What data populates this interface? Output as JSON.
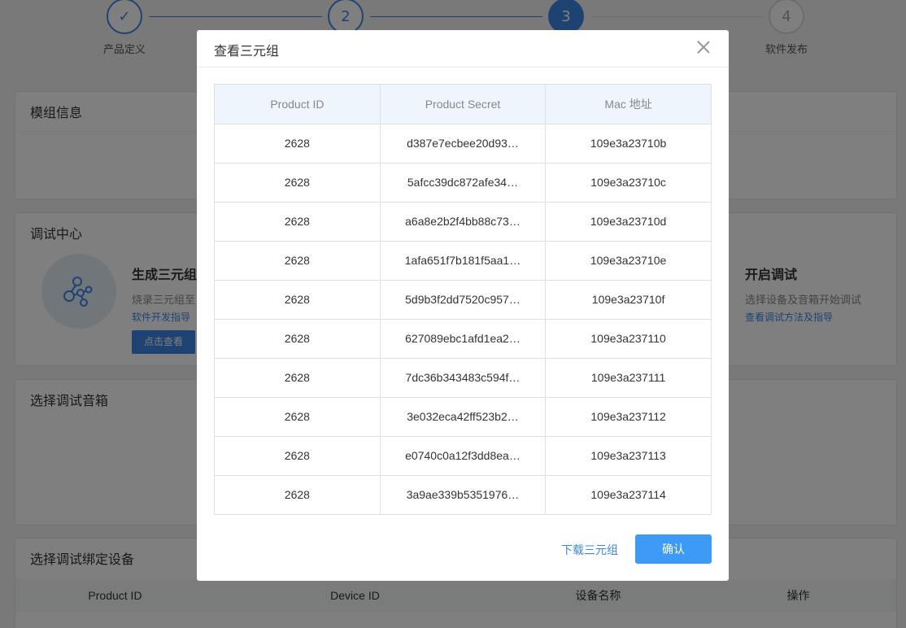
{
  "steps": [
    {
      "number": "✓",
      "label": "产品定义",
      "state": "done"
    },
    {
      "number": "2",
      "label": "",
      "state": "done"
    },
    {
      "number": "3",
      "label": "",
      "state": "current"
    },
    {
      "number": "4",
      "label": "软件发布",
      "state": "todo"
    }
  ],
  "cards": {
    "module_info": {
      "title": "模组信息"
    },
    "debug_center": {
      "title": "调试中心",
      "generate": {
        "heading": "生成三元组",
        "desc": "烧录三元组至",
        "link": "软件开发指导",
        "button": "点击查看"
      },
      "start": {
        "heading": "开启调试",
        "desc": "选择设备及音箱开始调试",
        "link": "查看调试方法及指导"
      }
    },
    "select_speaker": {
      "title": "选择调试音箱"
    },
    "select_device": {
      "title": "选择调试绑定设备",
      "columns": [
        "Product ID",
        "Device ID",
        "设备名称",
        "操作"
      ]
    }
  },
  "modal": {
    "title": "查看三元组",
    "columns": [
      "Product ID",
      "Product Secret",
      "Mac 地址"
    ],
    "rows": [
      {
        "product_id": "2628",
        "secret": "d387e7ecbee20d93…",
        "mac": "109e3a23710b"
      },
      {
        "product_id": "2628",
        "secret": "5afcc39dc872afe34…",
        "mac": "109e3a23710c"
      },
      {
        "product_id": "2628",
        "secret": "a6a8e2b2f4bb88c73…",
        "mac": "109e3a23710d"
      },
      {
        "product_id": "2628",
        "secret": "1afa651f7b181f5aa1…",
        "mac": "109e3a23710e"
      },
      {
        "product_id": "2628",
        "secret": "5d9b3f2dd7520c957…",
        "mac": "109e3a23710f"
      },
      {
        "product_id": "2628",
        "secret": "627089ebc1afd1ea2…",
        "mac": "109e3a237110"
      },
      {
        "product_id": "2628",
        "secret": "7dc36b343483c594f…",
        "mac": "109e3a237111"
      },
      {
        "product_id": "2628",
        "secret": "3e032eca42ff523b2…",
        "mac": "109e3a237112"
      },
      {
        "product_id": "2628",
        "secret": "e0740c0a12f3dd8ea…",
        "mac": "109e3a237113"
      },
      {
        "product_id": "2628",
        "secret": "3a9ae339b5351976…",
        "mac": "109e3a237114"
      }
    ],
    "download_label": "下载三元组",
    "confirm_label": "确认"
  },
  "colors": {
    "accent": "#3d86e4",
    "confirm": "#3d9bf7",
    "header_bg": "#eef5fc"
  }
}
